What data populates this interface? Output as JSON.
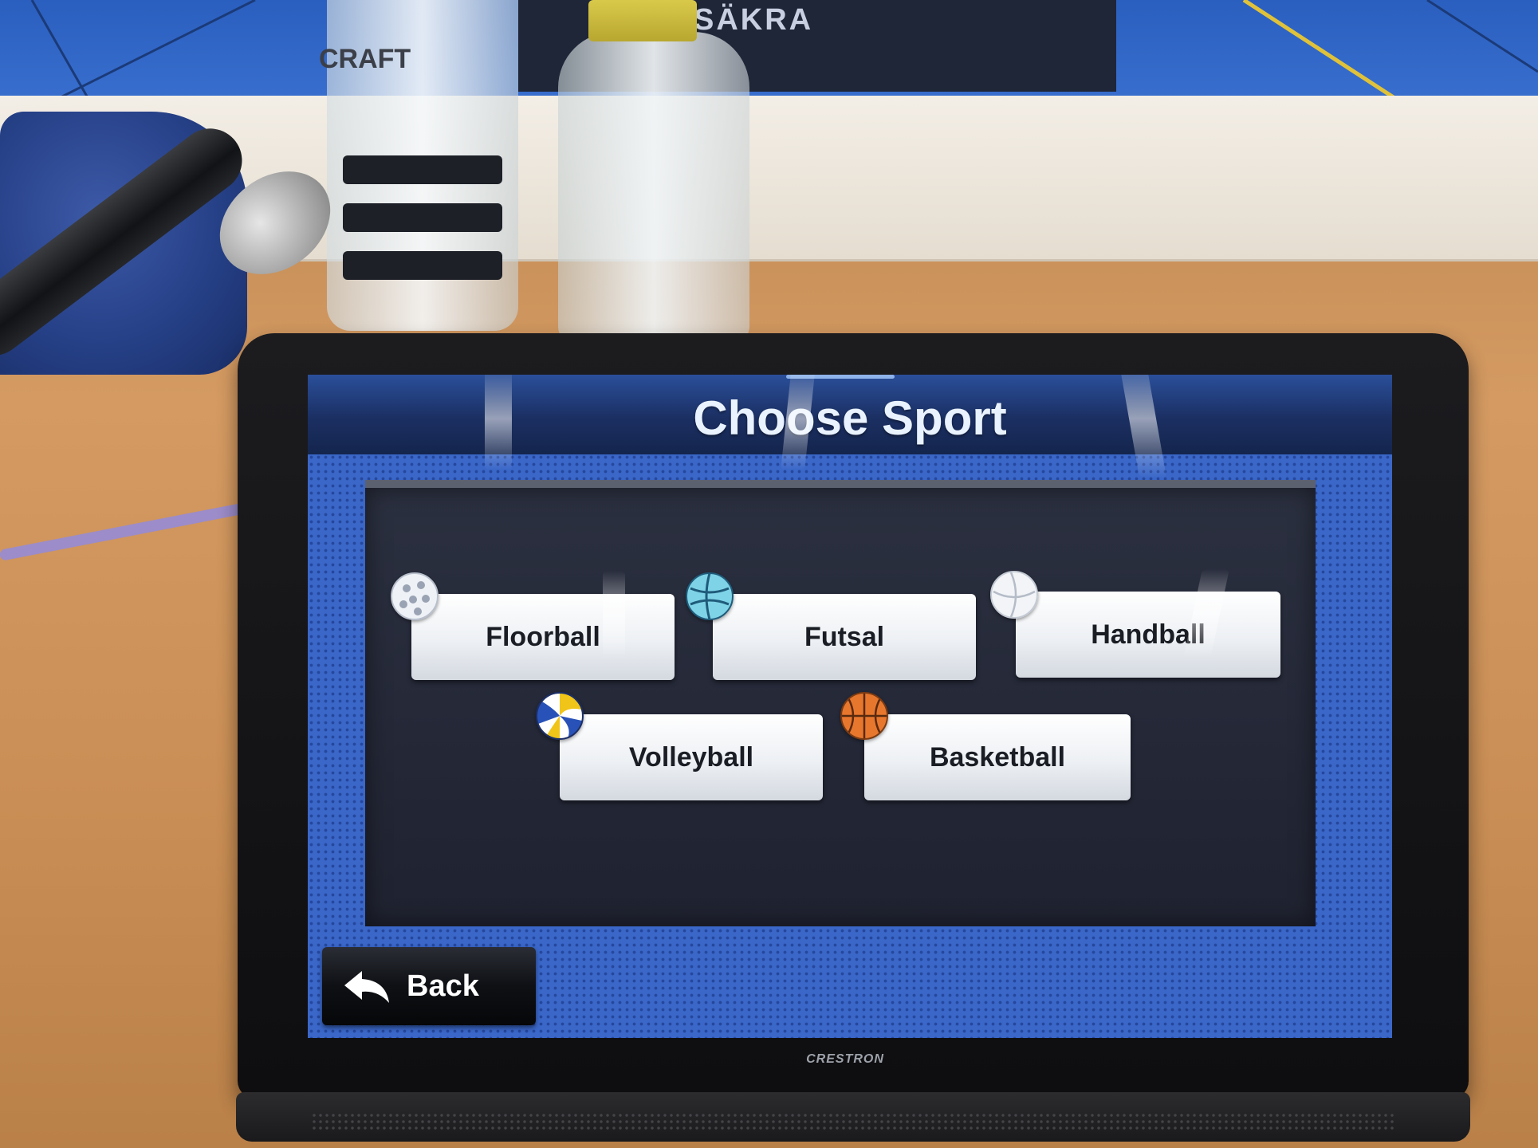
{
  "screen": {
    "title": "Choose Sport",
    "accent_color": "#3a67c8"
  },
  "sports": [
    {
      "label": "Floorball",
      "icon": "floorball-icon"
    },
    {
      "label": "Futsal",
      "icon": "futsal-ball-icon"
    },
    {
      "label": "Handball",
      "icon": "handball-icon"
    },
    {
      "label": "Volleyball",
      "icon": "volleyball-icon"
    },
    {
      "label": "Basketball",
      "icon": "basketball-icon"
    }
  ],
  "navigation": {
    "back_label": "Back",
    "back_icon": "back-arrow-icon"
  },
  "device": {
    "brand": "CRESTRON"
  },
  "background": {
    "banner_text": "SÄKRA",
    "glass_brand": "CRAFT"
  }
}
